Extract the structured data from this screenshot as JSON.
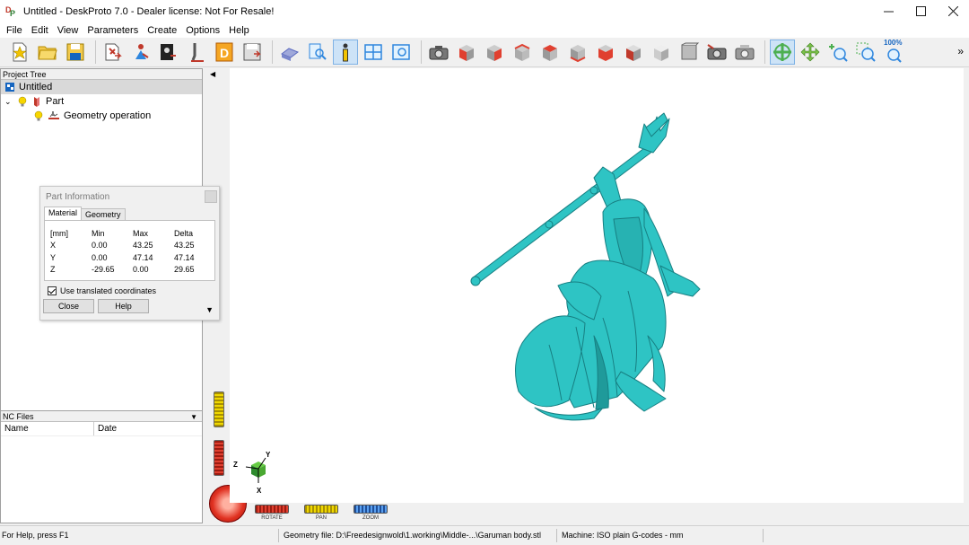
{
  "window": {
    "title": "Untitled - DeskProto 7.0 - Dealer license: Not For Resale!",
    "logo_letters": "DP",
    "controls": [
      "minimize",
      "maximize",
      "close"
    ]
  },
  "menu": [
    "File",
    "Edit",
    "View",
    "Parameters",
    "Create",
    "Options",
    "Help"
  ],
  "toolbar": {
    "zoom_label": "100%",
    "buttons": [
      "new-project-icon",
      "open-folder-icon",
      "save-disk-icon",
      "import-part-icon",
      "import-vector-icon",
      "import-bitmap-icon",
      "toolpath-icon",
      "nc-file-icon",
      "save-nc-icon",
      "render-shade-icon",
      "find-icon",
      "info-icon",
      "layout-icon",
      "preview-icon",
      "camera-icon",
      "view-front-icon",
      "view-right-icon",
      "view-back-icon",
      "view-left-icon",
      "view-top-icon",
      "view-bottom-icon",
      "view-iso-icon",
      "view-gray-icon",
      "view-cube-icon",
      "snapshot-icon",
      "print-icon",
      "rotate-tool-icon",
      "pan-tool-icon",
      "zoom-in-icon",
      "zoom-window-icon",
      "zoom-100-icon"
    ],
    "active": [
      "info-icon",
      "rotate-tool-icon"
    ],
    "overflow": "»"
  },
  "project_tree": {
    "header": "Project Tree",
    "root": "Untitled",
    "items": [
      {
        "label": "Part",
        "level": 1,
        "expanded": true
      },
      {
        "label": "Geometry operation",
        "level": 2
      }
    ]
  },
  "nc_files": {
    "header": "NC Files",
    "columns": [
      "Name",
      "Date"
    ]
  },
  "part_info": {
    "title": "Part Information",
    "tabs": [
      "Material",
      "Geometry"
    ],
    "active_tab": "Material",
    "header": [
      "[mm]",
      "Min",
      "Max",
      "Delta"
    ],
    "rows": [
      [
        "X",
        "0.00",
        "43.25",
        "43.25"
      ],
      [
        "Y",
        "0.00",
        "47.14",
        "47.14"
      ],
      [
        "Z",
        "-29.65",
        "0.00",
        "29.65"
      ]
    ],
    "checkbox_label": "Use translated coordinates",
    "checkbox_checked": true,
    "close_label": "Close",
    "help_label": "Help"
  },
  "viewport": {
    "model_color": "#2ec4c4",
    "axes": {
      "x": "X",
      "y": "Y",
      "z": "Z"
    },
    "controls": [
      {
        "label": "ROTATE",
        "color": "#e04030"
      },
      {
        "label": "PAN",
        "color": "#f0d800"
      },
      {
        "label": "ZOOM",
        "color": "#3a7bd5"
      }
    ]
  },
  "status": {
    "help": "For Help, press F1",
    "geometry": "Geometry file: D:\\Freedesignwold\\1.working\\Middle-...\\Garuman body.stl",
    "machine": "Machine: ISO plain G-codes - mm"
  }
}
